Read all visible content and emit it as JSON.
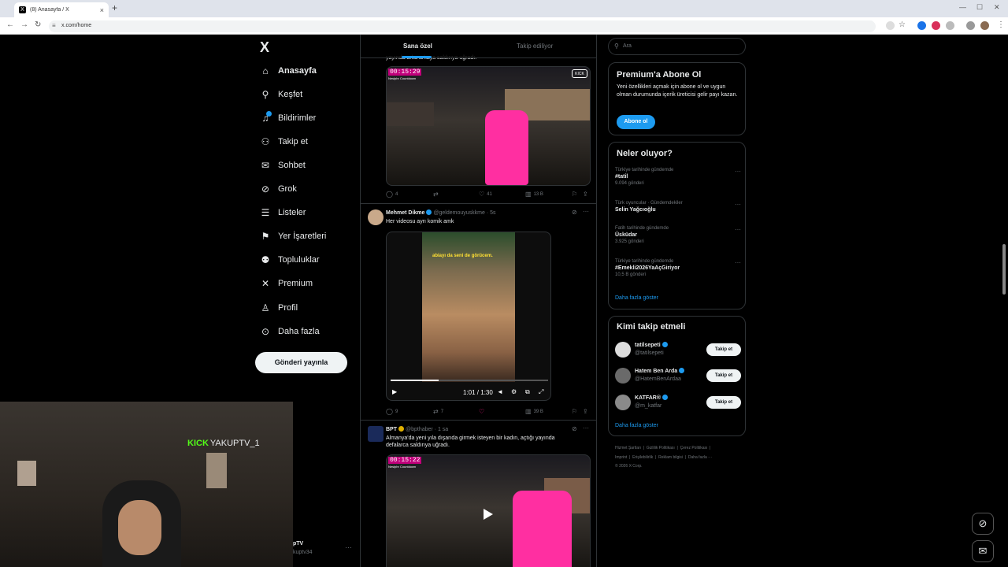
{
  "browser": {
    "tab_title": "(8) Anasayfa / X",
    "tab_close": "×",
    "new_tab": "+",
    "url": "x.com/home"
  },
  "nav": {
    "logo": "X",
    "items": [
      {
        "label": "Anasayfa",
        "icon": "home-icon"
      },
      {
        "label": "Keşfet",
        "icon": "search-icon"
      },
      {
        "label": "Bildirimler",
        "icon": "bell-icon"
      },
      {
        "label": "Takip et",
        "icon": "person-add-icon"
      },
      {
        "label": "Sohbet",
        "icon": "mail-icon"
      },
      {
        "label": "Grok",
        "icon": "grok-icon"
      },
      {
        "label": "Listeler",
        "icon": "list-icon"
      },
      {
        "label": "Yer İşaretleri",
        "icon": "bookmark-icon"
      },
      {
        "label": "Topluluklar",
        "icon": "communities-icon"
      },
      {
        "label": "Premium",
        "icon": "x-icon"
      },
      {
        "label": "Profil",
        "icon": "profile-icon"
      },
      {
        "label": "Daha fazla",
        "icon": "more-icon"
      }
    ],
    "post_button": "Gönderi yayınla"
  },
  "feed": {
    "tabs": [
      "Sana özel",
      "Takip ediliyor"
    ],
    "tweet1": {
      "text_tail": "yayında arka arkaya saldırıya uğradı.",
      "timer": "00:15:29",
      "timer_sub": "Nesiphr Countdown",
      "watermark": "KICK",
      "stats": {
        "replies": "4",
        "likes": "41",
        "views": "13 B"
      }
    },
    "tweet2": {
      "name": "Mehmet Dikme",
      "handle": "@geldemouyuskkme · 5s",
      "text": "Her videosu ayrı komik amk",
      "caption": "abiayı da seni de görücem.",
      "video_time": "1:01 / 1:30",
      "stats": {
        "replies": "9",
        "retweets": "7",
        "views": "39 B"
      }
    },
    "tweet3": {
      "name": "BPT",
      "handle": "@bpthaber · 1 sa",
      "text": "Almanya'da yeni yıla dışarıda girmek isteyen bir kadın, açtığı yayında defalarca saldırıya uğradı.",
      "timer": "00:15:22",
      "timer_sub": "Nesiphr Countdown"
    },
    "more": "···"
  },
  "right": {
    "search_placeholder": "Ara",
    "premium": {
      "title": "Premium'a Abone Ol",
      "text": "Yeni özellikleri açmak için abone ol ve uygun olman durumunda içerik üreticisi gelir payı kazan.",
      "button": "Abone ol"
    },
    "trends": {
      "title": "Neler oluyor?",
      "items": [
        {
          "context": "Türkiye tarihinde gündemde",
          "topic": "#tatil",
          "count": "9.094 gönderi"
        },
        {
          "context": "Türk oyuncular · Gündemdekiler",
          "topic": "Selin Yağcıoğlu",
          "count": ""
        },
        {
          "context": "Fatih tarihinde gündemde",
          "topic": "Üsküdar",
          "count": "3.925 gönderi"
        },
        {
          "context": "Türkiye tarihinde gündemde",
          "topic": "#Emekli2026YaAçGiriyor",
          "count": "10,5 B gönderi"
        }
      ],
      "show_more": "Daha fazla göster"
    },
    "who_to_follow": {
      "title": "Kimi takip etmeli",
      "users": [
        {
          "name": "tatilsepeti",
          "handle": "@tatilsepeti"
        },
        {
          "name": "Hatem Ben Arda",
          "handle": "@HatemBenArdaa"
        },
        {
          "name": "KATFAR®",
          "handle": "@m_katfar"
        }
      ],
      "follow_label": "Takip et",
      "show_more": "Daha fazla göster"
    },
    "footer": {
      "line1": [
        "Hizmet Şartları",
        "Gizlilik Politikası",
        "Çerez Politikası"
      ],
      "line2": [
        "Imprint",
        "Erişilebilirlik",
        "Reklam bilgisi",
        "Daha fazla ···"
      ],
      "copyright": "© 2026 X Corp."
    }
  },
  "overlay": {
    "kick_brand": "KICK",
    "kick_user": "YAKUPTV_1",
    "account_name": "pTV",
    "account_handle": "kuptv34",
    "account_more": "···"
  },
  "colors": {
    "accent": "#1d9bf0",
    "kick": "#53fc18",
    "pink": "#ff2fa1"
  }
}
